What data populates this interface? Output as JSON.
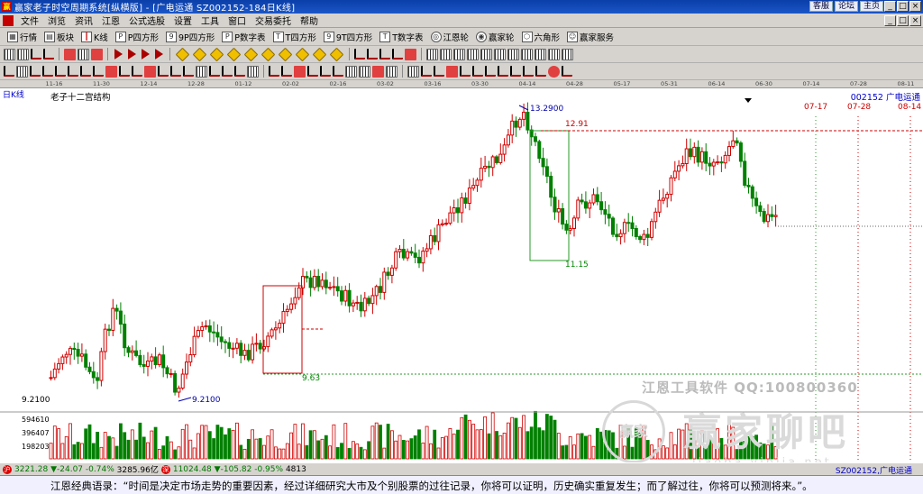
{
  "window": {
    "title": "赢家老子时空周期系统[纵横版] - [广电运通   SZ002152-184日K线]",
    "right_links": [
      "客服",
      "论坛",
      "主页"
    ],
    "buttons": [
      "_",
      "□",
      "×"
    ]
  },
  "menu": [
    "文件",
    "浏览",
    "资讯",
    "江恩",
    "公式选股",
    "设置",
    "工具",
    "窗口",
    "交易委托",
    "帮助"
  ],
  "toolbar1": [
    {
      "icon": "table-icon",
      "label": "行情"
    },
    {
      "icon": "blocks-icon",
      "label": "板块"
    },
    {
      "icon": "kline-icon",
      "label": "K线"
    },
    {
      "icon": "p-square-icon",
      "label": "P四方形"
    },
    {
      "icon": "9p-square-icon",
      "label": "9P四方形"
    },
    {
      "icon": "p-number-icon",
      "label": "P数字表"
    },
    {
      "icon": "t-square-icon",
      "label": "T四方形"
    },
    {
      "icon": "9t-square-icon",
      "label": "9T四方形"
    },
    {
      "icon": "t-number-icon",
      "label": "T数字表"
    },
    {
      "icon": "gann-wheel-icon",
      "label": "江恩轮"
    },
    {
      "icon": "winner-wheel-icon",
      "label": "赢家轮"
    },
    {
      "icon": "hexagon-icon",
      "label": "六角形"
    },
    {
      "icon": "service-icon",
      "label": "赢家服务"
    }
  ],
  "chart": {
    "period": "日K线",
    "structure_title": "老子十二宫结构",
    "stock": "002152 广电运通",
    "dates": [
      "11-16",
      "11-30",
      "12-14",
      "12-28",
      "01-12",
      "02-02",
      "02-16",
      "03-02",
      "03-16",
      "03-30",
      "04-14",
      "04-28",
      "05-17",
      "05-31",
      "06-14",
      "06-30",
      "07-14",
      "07-28",
      "08-11"
    ],
    "future_dates": [
      "07-17",
      "07-28",
      "08-14"
    ],
    "high_label": "13.2900",
    "low_label": "9.2100",
    "low_axis": "9.2100",
    "level_1291": "12.91",
    "level_1115": "11.15",
    "level_963": "9.63",
    "volume_ticks": [
      "594610",
      "396407",
      "198203"
    ],
    "watermark_text": "江恩工具软件  QQ:100800360",
    "watermark_logo": "赢家",
    "watermark_brand": "赢家聊吧",
    "watermark_url": "jiaoba.yinjia.net",
    "colors": {
      "up": "#d00000",
      "down": "#008000",
      "dashed": "#d00000",
      "grid": "#2a9a2a"
    }
  },
  "status": {
    "sh_value": "3221.28",
    "sh_change": "▼-24.07",
    "sh_pct": "-0.74%",
    "sh_amount": "3285.96亿",
    "sz_value": "11024.48",
    "sz_change": "▼-105.82",
    "sz_pct": "-0.95%",
    "sz_amount": "4813",
    "right": "SZ002152,广电运通"
  },
  "quote": "江恩经典语录：“时间是决定市场走势的重要因素，经过详细研究大市及个别股票的过往记录，你将可以证明，历史确实重复发生；而了解过往，你将可以预测将来。”。"
}
